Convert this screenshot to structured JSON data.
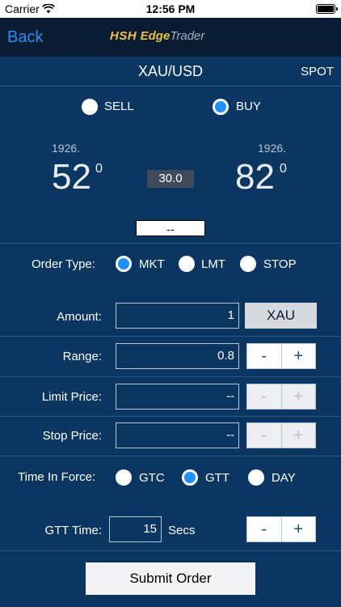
{
  "status_bar": {
    "carrier": "Carrier",
    "time": "12:56 PM"
  },
  "nav": {
    "back_label": "Back",
    "logo_part1": "HSH",
    "logo_part2": "Edge",
    "logo_part3": "Trader"
  },
  "instrument": {
    "symbol": "XAU/USD",
    "market": "SPOT"
  },
  "side": {
    "sell_label": "SELL",
    "buy_label": "BUY",
    "selected": "BUY"
  },
  "prices": {
    "sell_big": "1926.",
    "sell_main": "52",
    "sell_pip": "0",
    "buy_big": "1926.",
    "buy_main": "82",
    "buy_pip": "0",
    "spread": "30.0",
    "indicator": "--"
  },
  "order_type": {
    "label": "Order Type:",
    "options": [
      "MKT",
      "LMT",
      "STOP"
    ],
    "selected": "MKT"
  },
  "amount": {
    "label": "Amount:",
    "value": "1",
    "unit": "XAU"
  },
  "range": {
    "label": "Range:",
    "value": "0.8",
    "minus": "-",
    "plus": "+"
  },
  "limit_price": {
    "label": "Limit Price:",
    "value": "--",
    "minus": "-",
    "plus": "+"
  },
  "stop_price": {
    "label": "Stop Price:",
    "value": "--",
    "minus": "-",
    "plus": "+"
  },
  "time_in_force": {
    "label": "Time In Force:",
    "options": [
      "GTC",
      "GTT",
      "DAY"
    ],
    "selected": "GTT"
  },
  "gtt_time": {
    "label": "GTT Time:",
    "value": "15",
    "unit": "Secs",
    "minus": "-",
    "plus": "+"
  },
  "submit_label": "Submit Order"
}
